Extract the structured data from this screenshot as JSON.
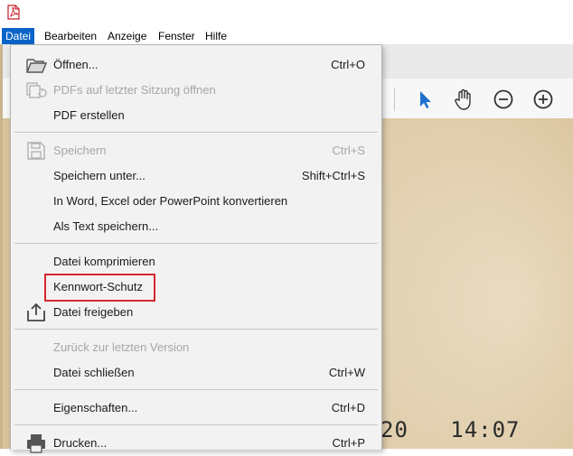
{
  "menubar": {
    "items": [
      "Datei",
      "Bearbeiten",
      "Anzeige",
      "Fenster",
      "Hilfe"
    ]
  },
  "document": {
    "stamp_text": "20   14:07"
  },
  "toolbar_icons": [
    "select-arrow-icon",
    "hand-tool-icon",
    "zoom-out-icon",
    "zoom-in-icon"
  ],
  "menu": {
    "items": [
      {
        "label": "Öffnen...",
        "shortcut": "Ctrl+O",
        "enabled": true,
        "icon": "folder-open-icon"
      },
      {
        "label": "PDFs auf letzter Sitzung öffnen",
        "shortcut": "",
        "enabled": false,
        "icon": "restore-session-icon"
      },
      {
        "label": "PDF erstellen",
        "shortcut": "",
        "enabled": true,
        "icon": ""
      },
      {
        "label": "Speichern",
        "shortcut": "Ctrl+S",
        "enabled": false,
        "icon": "save-icon"
      },
      {
        "label": "Speichern unter...",
        "shortcut": "Shift+Ctrl+S",
        "enabled": true,
        "icon": ""
      },
      {
        "label": "In Word, Excel oder PowerPoint konvertieren",
        "shortcut": "",
        "enabled": true,
        "icon": ""
      },
      {
        "label": "Als Text speichern...",
        "shortcut": "",
        "enabled": true,
        "icon": ""
      },
      {
        "label": "Datei komprimieren",
        "shortcut": "",
        "enabled": true,
        "icon": ""
      },
      {
        "label": "Kennwort-Schutz",
        "shortcut": "",
        "enabled": true,
        "icon": ""
      },
      {
        "label": "Datei freigeben",
        "shortcut": "",
        "enabled": true,
        "icon": "share-icon"
      },
      {
        "label": "Zurück zur letzten Version",
        "shortcut": "",
        "enabled": false,
        "icon": ""
      },
      {
        "label": "Datei schließen",
        "shortcut": "Ctrl+W",
        "enabled": true,
        "icon": ""
      },
      {
        "label": "Eigenschaften...",
        "shortcut": "Ctrl+D",
        "enabled": true,
        "icon": ""
      },
      {
        "label": "Drucken...",
        "shortcut": "Ctrl+P",
        "enabled": true,
        "icon": "printer-icon"
      }
    ]
  },
  "colors": {
    "menu_active": "#0a64c8",
    "highlight_border": "#d7262e",
    "tool_active": "#1f6fd1"
  }
}
